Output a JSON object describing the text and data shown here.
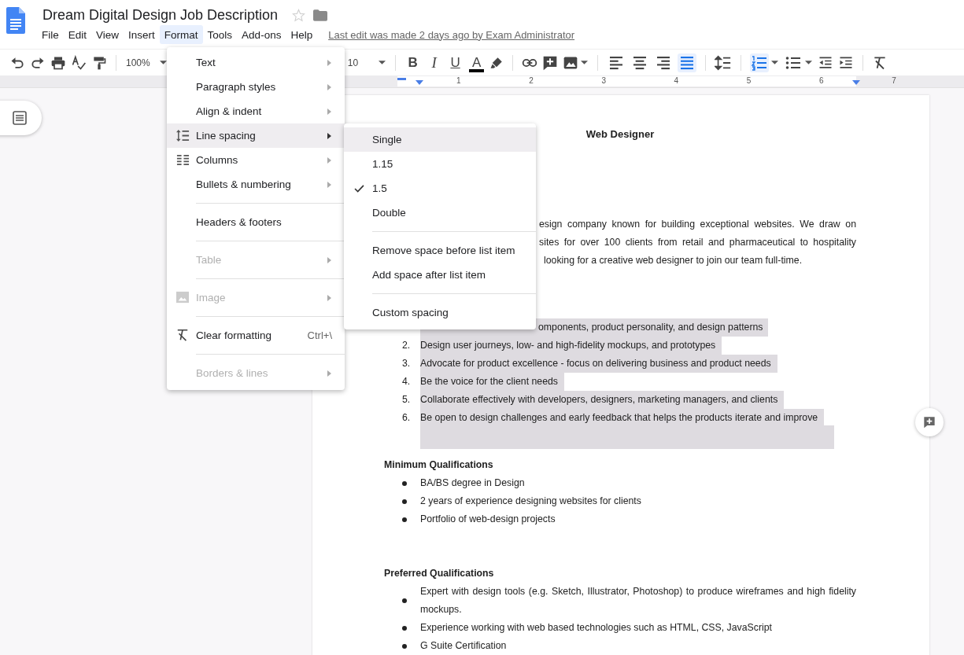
{
  "app": {
    "title": "Dream Digital Design Job Description",
    "starred": false,
    "last_edit": "Last edit was made 2 days ago by Exam Administrator"
  },
  "menubar": [
    {
      "label": "File",
      "selected": false
    },
    {
      "label": "Edit",
      "selected": false
    },
    {
      "label": "View",
      "selected": false
    },
    {
      "label": "Insert",
      "selected": false
    },
    {
      "label": "Format",
      "selected": true
    },
    {
      "label": "Tools",
      "selected": false
    },
    {
      "label": "Add-ons",
      "selected": false
    },
    {
      "label": "Help",
      "selected": false
    }
  ],
  "toolbar": {
    "zoom": "100%",
    "font_size": "10",
    "text_style": [
      {
        "label": "B",
        "kind": "bold"
      },
      {
        "label": "I",
        "kind": "italic"
      },
      {
        "label": "U",
        "kind": "underline"
      },
      {
        "label": "A",
        "kind": "color"
      }
    ],
    "alignments": [
      {
        "kind": "left",
        "selected": false
      },
      {
        "kind": "center",
        "selected": false
      },
      {
        "kind": "right",
        "selected": false
      },
      {
        "kind": "justify",
        "selected": true
      }
    ],
    "lists": [
      {
        "kind": "numbered",
        "selected": true
      },
      {
        "kind": "bulleted",
        "selected": false
      }
    ]
  },
  "ruler": [
    "1",
    "2",
    "3",
    "4",
    "5",
    "6",
    "7"
  ],
  "format_menu": [
    [
      {
        "label": "Text",
        "submenu": true,
        "disabled": false,
        "selected": false
      },
      {
        "label": "Paragraph styles",
        "submenu": true,
        "disabled": false,
        "selected": false
      },
      {
        "label": "Align & indent",
        "submenu": true,
        "disabled": false,
        "selected": false
      },
      {
        "label": "Line spacing",
        "submenu": true,
        "disabled": false,
        "selected": true
      },
      {
        "label": "Columns",
        "submenu": true,
        "disabled": false,
        "selected": false
      },
      {
        "label": "Bullets & numbering",
        "submenu": true,
        "disabled": false,
        "selected": false
      }
    ],
    [
      {
        "label": "Headers & footers",
        "submenu": false,
        "disabled": false,
        "selected": false
      }
    ],
    [
      {
        "label": "Table",
        "submenu": true,
        "disabled": true,
        "selected": false
      }
    ],
    [
      {
        "label": "Image",
        "submenu": true,
        "disabled": true,
        "selected": false
      }
    ],
    [
      {
        "label": "Clear formatting",
        "submenu": false,
        "disabled": false,
        "selected": false,
        "shortcut": "Ctrl+\\"
      }
    ],
    [
      {
        "label": "Borders & lines",
        "submenu": true,
        "disabled": true,
        "selected": false
      }
    ]
  ],
  "line_spacing_menu": [
    [
      {
        "label": "Single",
        "selected": true,
        "checked": false
      },
      {
        "label": "1.15",
        "selected": false,
        "checked": false
      },
      {
        "label": "1.5",
        "selected": false,
        "checked": true
      },
      {
        "label": "Double",
        "selected": false,
        "checked": false
      }
    ],
    [
      {
        "label": "Remove space before list item",
        "selected": false,
        "checked": false
      },
      {
        "label": "Add space after list item",
        "selected": false,
        "checked": false
      }
    ],
    [
      {
        "label": "Custom spacing",
        "selected": false,
        "checked": false
      }
    ]
  ],
  "document": {
    "title": "Web Designer",
    "intro_lines": [
      "esign company known for building exceptional websites. We draw on",
      "sites for over 100 clients from retail and pharmaceutical to hospitality",
      "looking for a creative web designer to join our team full-time."
    ],
    "responsibilities": [
      {
        "text": "omponents, product personality, and design patterns",
        "highlighted": true
      },
      {
        "number": "2.",
        "text": "Design user journeys, low- and high-fidelity mockups, and prototypes",
        "highlighted": true
      },
      {
        "number": "3.",
        "text": "Advocate for product excellence - focus on delivering business and product needs",
        "highlighted": true
      },
      {
        "number": "4.",
        "text": "Be the voice for the client needs",
        "highlighted": true
      },
      {
        "number": "5.",
        "text": "Collaborate effectively with developers, designers, marketing managers, and clients",
        "highlighted": true
      },
      {
        "number": "6.",
        "text": "Be open to design challenges and early feedback that helps the products iterate and improve",
        "highlighted": true
      }
    ],
    "selected_blank_line": true,
    "sections": [
      {
        "heading": "Minimum Qualifications",
        "bullets": [
          "BA/BS degree in Design",
          "2 years of experience designing websites for clients",
          "Portfolio of web-design projects"
        ]
      },
      {
        "heading": "Preferred Qualifications",
        "bullets": [
          "Expert with design tools (e.g. Sketch, Illustrator, Photoshop) to produce wireframes and high fidelity mockups.",
          "Experience working with web based technologies such as HTML, CSS, JavaScript",
          "G Suite Certification"
        ]
      }
    ]
  }
}
